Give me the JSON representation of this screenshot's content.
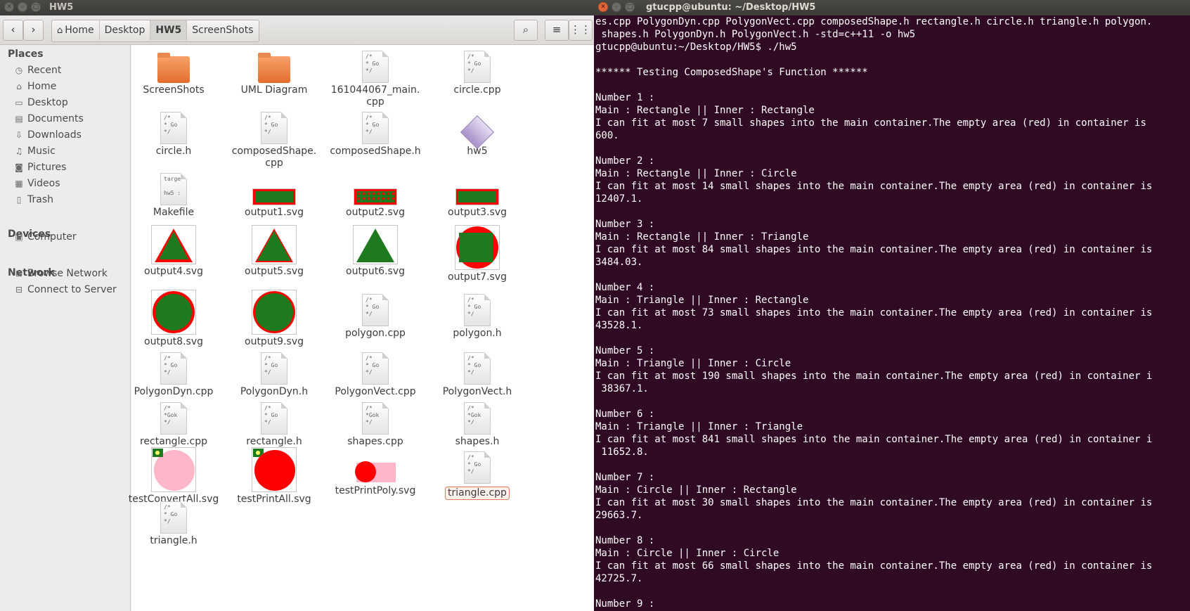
{
  "file_manager": {
    "title": "HW5",
    "breadcrumbs": [
      "Home",
      "Desktop",
      "HW5",
      "ScreenShots"
    ],
    "active_crumb": "HW5",
    "sidebar": {
      "places_heading": "Places",
      "places": [
        {
          "label": "Recent",
          "icon": "clock-icon"
        },
        {
          "label": "Home",
          "icon": "home-icon"
        },
        {
          "label": "Desktop",
          "icon": "desktop-icon"
        },
        {
          "label": "Documents",
          "icon": "documents-icon"
        },
        {
          "label": "Downloads",
          "icon": "download-icon"
        },
        {
          "label": "Music",
          "icon": "music-icon"
        },
        {
          "label": "Pictures",
          "icon": "camera-icon"
        },
        {
          "label": "Videos",
          "icon": "film-icon"
        },
        {
          "label": "Trash",
          "icon": "trash-icon"
        }
      ],
      "devices_heading": "Devices",
      "devices": [
        {
          "label": "Computer",
          "icon": "drive-icon"
        }
      ],
      "network_heading": "Network",
      "network": [
        {
          "label": "Browse Network",
          "icon": "network-icon"
        },
        {
          "label": "Connect to Server",
          "icon": "server-icon"
        }
      ]
    },
    "files": [
      {
        "name": "ScreenShots",
        "kind": "folder"
      },
      {
        "name": "UML Diagram",
        "kind": "folder"
      },
      {
        "name": "161044067_main.\ncpp",
        "kind": "doc",
        "preview": "/*\n * Go\n*/"
      },
      {
        "name": "circle.cpp",
        "kind": "doc",
        "preview": "/*\n * Go\n*/"
      },
      {
        "name": "circle.h",
        "kind": "doc",
        "preview": "/*\n * Go\n*/"
      },
      {
        "name": "composedShape.\ncpp",
        "kind": "doc",
        "preview": "/*\n * Go\n*/"
      },
      {
        "name": "composedShape.h",
        "kind": "doc",
        "preview": "/*\n * Go\n*/"
      },
      {
        "name": "hw5",
        "kind": "exe"
      },
      {
        "name": "Makefile",
        "kind": "doc",
        "preview": "targe\n\nhw5 :"
      },
      {
        "name": "output1.svg",
        "kind": "svg-rect"
      },
      {
        "name": "output2.svg",
        "kind": "svg-rect-dots"
      },
      {
        "name": "output3.svg",
        "kind": "svg-rect"
      },
      {
        "name": "output4.svg",
        "kind": "svg-tri-rect"
      },
      {
        "name": "output5.svg",
        "kind": "svg-tri"
      },
      {
        "name": "output6.svg",
        "kind": "svg-tri-plain"
      },
      {
        "name": "output7.svg",
        "kind": "svg-circle-rect"
      },
      {
        "name": "output8.svg",
        "kind": "svg-circle-dots"
      },
      {
        "name": "output9.svg",
        "kind": "svg-circle"
      },
      {
        "name": "polygon.cpp",
        "kind": "doc",
        "preview": "/*\n * Go\n*/"
      },
      {
        "name": "polygon.h",
        "kind": "doc",
        "preview": "/*\n * Go\n*/"
      },
      {
        "name": "PolygonDyn.cpp",
        "kind": "doc",
        "preview": "/*\n * Go\n*/"
      },
      {
        "name": "PolygonDyn.h",
        "kind": "doc",
        "preview": "/*\n * Go\n*/"
      },
      {
        "name": "PolygonVect.cpp",
        "kind": "doc",
        "preview": "/*\n * Go\n*/"
      },
      {
        "name": "PolygonVect.h",
        "kind": "doc",
        "preview": "/*\n * Go\n*/"
      },
      {
        "name": "rectangle.cpp",
        "kind": "doc",
        "preview": "/*\n *Gok\n*/"
      },
      {
        "name": "rectangle.h",
        "kind": "doc",
        "preview": "/*\n * Go\n*/"
      },
      {
        "name": "shapes.cpp",
        "kind": "doc",
        "preview": "/*\n *Gok\n*/"
      },
      {
        "name": "shapes.h",
        "kind": "doc",
        "preview": "/*\n *Gok\n*/"
      },
      {
        "name": "testConvertAll.svg",
        "kind": "svg-pink"
      },
      {
        "name": "testPrintAll.svg",
        "kind": "svg-red"
      },
      {
        "name": "testPrintPoly.svg",
        "kind": "svg-poly"
      },
      {
        "name": "triangle.cpp",
        "kind": "doc",
        "preview": "/*\n * Go\n*/",
        "selected": true
      },
      {
        "name": "triangle.h",
        "kind": "doc",
        "preview": "/*\n * Go\n*/"
      }
    ]
  },
  "terminal": {
    "title": "gtucpp@ubuntu: ~/Desktop/HW5",
    "lines": [
      "es.cpp PolygonDyn.cpp PolygonVect.cpp composedShape.h rectangle.h circle.h triangle.h polygon.",
      " shapes.h PolygonDyn.h PolygonVect.h -std=c++11 -o hw5",
      "gtucpp@ubuntu:~/Desktop/HW5$ ./hw5",
      "",
      "****** Testing ComposedShape's Function ******",
      "",
      "Number 1 :",
      "Main : Rectangle || Inner : Rectangle",
      "I can fit at most 7 small shapes into the main container.The empty area (red) in container is",
      "600.",
      "",
      "Number 2 :",
      "Main : Rectangle || Inner : Circle",
      "I can fit at most 14 small shapes into the main container.The empty area (red) in container is",
      "12407.1.",
      "",
      "Number 3 :",
      "Main : Rectangle || Inner : Triangle",
      "I can fit at most 84 small shapes into the main container.The empty area (red) in container is",
      "3484.03.",
      "",
      "Number 4 :",
      "Main : Triangle || Inner : Rectangle",
      "I can fit at most 73 small shapes into the main container.The empty area (red) in container is",
      "43528.1.",
      "",
      "Number 5 :",
      "Main : Triangle || Inner : Circle",
      "I can fit at most 190 small shapes into the main container.The empty area (red) in container i",
      " 38367.1.",
      "",
      "Number 6 :",
      "Main : Triangle || Inner : Triangle",
      "I can fit at most 841 small shapes into the main container.The empty area (red) in container i",
      " 11652.8.",
      "",
      "Number 7 :",
      "Main : Circle || Inner : Rectangle",
      "I can fit at most 30 small shapes into the main container.The empty area (red) in container is",
      "29663.7.",
      "",
      "Number 8 :",
      "Main : Circle || Inner : Circle",
      "I can fit at most 66 small shapes into the main container.The empty area (red) in container is",
      "42725.7.",
      "",
      "Number 9 :"
    ]
  }
}
